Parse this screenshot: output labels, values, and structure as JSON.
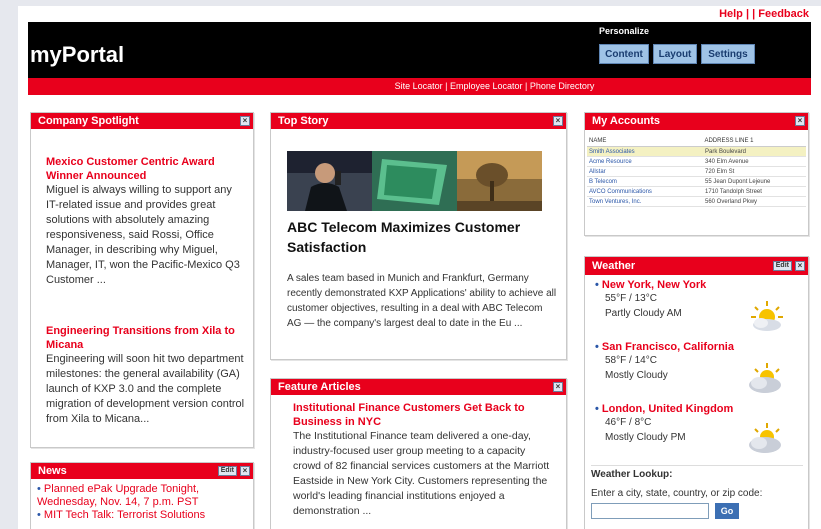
{
  "top_links": {
    "help": "Help",
    "sep1": "|",
    "sep2": "|",
    "feedback": "Feedback"
  },
  "header": {
    "logo": "myPortal",
    "personalize_label": "Personalize",
    "buttons": {
      "content": "Content",
      "layout": "Layout",
      "settings": "Settings"
    }
  },
  "subnav": {
    "site_locator": "Site Locator",
    "employee_locator": "Employee Locator",
    "phone_directory": "Phone Directory",
    "sep": "|"
  },
  "spotlight": {
    "title": "Company Spotlight",
    "close": "×",
    "items": [
      {
        "headline": "Mexico Customer Centric Award Winner Announced",
        "text": "Miguel is always willing to support any IT-related issue and provides great solutions with absolutely amazing responsiveness, said Rossi, Office Manager, in describing why Miguel, Manager, IT, won the Pacific-Mexico Q3 Customer ..."
      },
      {
        "headline": "Engineering Transitions from Xila to Micana",
        "text": "Engineering will soon hit two department milestones: the general availability (GA) launch of KXP 3.0 and the complete migration of development version control from Xila to Micana..."
      }
    ]
  },
  "top_story": {
    "title": "Top Story",
    "close": "×",
    "headline": "ABC Telecom Maximizes Customer Satisfaction",
    "text": "A sales team based in Munich and Frankfurt, Germany recently demonstrated KXP Applications' ability to achieve all customer objectives, resulting in a deal with ABC Telecom AG — the company's largest deal to date in the Eu ..."
  },
  "feature": {
    "title": "Feature Articles",
    "close": "×",
    "headline": "Institutional Finance Customers Get Back to Business in NYC",
    "text": "The Institutional Finance team delivered a one-day, industry-focused user group meeting to a capacity crowd of 82 financial services customers at the Marriott Eastside in New York City.  Customers representing the world's leading financial institutions enjoyed a demonstration ..."
  },
  "news": {
    "title": "News",
    "edit": "Edit",
    "close": "×",
    "items": [
      "Planned ePak Upgrade Tonight, Wednesday, Nov. 14, 7 p.m. PST",
      "MIT Tech Talk: Terrorist Solutions"
    ]
  },
  "accounts": {
    "title": "My Accounts",
    "close": "×",
    "col_name": "NAME",
    "col_address": "ADDRESS LINE 1",
    "rows": [
      {
        "name": "Smith Associates",
        "address": "Park Boulevard"
      },
      {
        "name": "Acme Resource",
        "address": "340 Elm Avenue"
      },
      {
        "name": "Allstar",
        "address": "720 Elm St"
      },
      {
        "name": "B Telecom",
        "address": "55 Jean Dupont Lejeune"
      },
      {
        "name": "AVCO Communications",
        "address": "1710 Tandolph Street"
      },
      {
        "name": "Town Ventures, Inc.",
        "address": "560 Overland Pkwy"
      }
    ]
  },
  "weather": {
    "title": "Weather",
    "edit": "Edit",
    "close": "×",
    "cities": [
      {
        "name": "New York, New York",
        "temp": "55°F / 13°C",
        "cond": "Partly Cloudy AM"
      },
      {
        "name": "San Francisco, California",
        "temp": "58°F / 14°C",
        "cond": "Mostly Cloudy"
      },
      {
        "name": "London, United Kingdom",
        "temp": "46°F / 8°C",
        "cond": "Mostly Cloudy PM"
      }
    ],
    "lookup_title": "Weather Lookup:",
    "lookup_prompt": "Enter a city, state, country, or zip code:",
    "go": "Go"
  }
}
